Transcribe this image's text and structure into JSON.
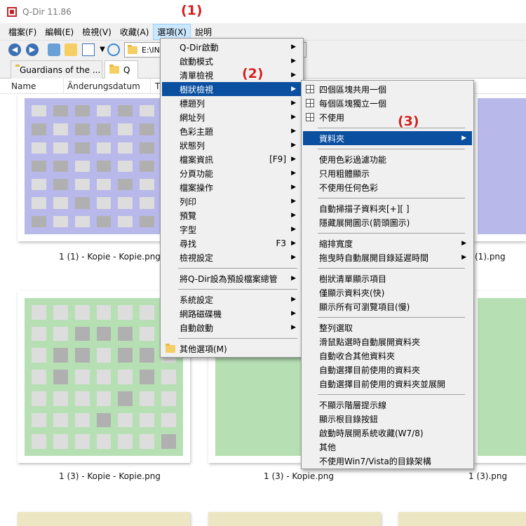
{
  "window": {
    "title": "Q-Dir 11.86"
  },
  "menubar": {
    "items": [
      "檔案(F)",
      "編輯(E)",
      "檢視(V)",
      "收藏(A)",
      "選項(X)",
      "說明"
    ]
  },
  "address": {
    "path": "E:\\INI"
  },
  "tabs": [
    "Guardians of the ...",
    "Q"
  ],
  "columns": {
    "name": "Name",
    "date": "Änderungsdatum",
    "type": "T"
  },
  "annotations": {
    "a1": "(1)",
    "a2": "(2)",
    "a3": "(3)"
  },
  "files": {
    "row1": [
      "1 (1) - Kopie - Kopie.png",
      "(1).png"
    ],
    "row2": [
      "1 (3) - Kopie - Kopie.png",
      "1 (3) - Kopie.png",
      "1 (3).png"
    ]
  },
  "colors": {
    "purple": "#b8b8ea",
    "green": "#b6e0b4",
    "gray": "#b0b0b0",
    "highlight": "#0a4fa0"
  },
  "menu1": {
    "items": [
      "Q-Dir啟動",
      "啟動模式",
      "清單檢視",
      "樹狀檢視",
      "標題列",
      "網址列",
      "色彩主題",
      "狀態列",
      "檔案資訊",
      "分頁功能",
      "檔案操作",
      "列印",
      "預覽",
      "字型",
      "尋找",
      "檢視設定",
      "將Q-Dir設為預設檔案總管",
      "系統設定",
      "網路磁碟機",
      "自動啟動",
      "其他選項(M)"
    ],
    "shortcuts": {
      "file_info": "[F9]",
      "find": "F3"
    }
  },
  "menu2": {
    "items": [
      "四個區塊共用一個",
      "每個區塊獨立一個",
      "不使用",
      "資料夾",
      "使用色彩過濾功能",
      "只用粗體顯示",
      "不使用任何色彩",
      "自動掃描子資料夾[+][ ]",
      "隱藏展開圖示(箭頭圖示)",
      "縮排寬度",
      "拖曳時自動展開目錄延遲時間",
      "樹狀清單顯示項目",
      "僅顯示資料夾(快)",
      "顯示所有可瀏覽項目(慢)",
      "整列選取",
      "滑鼠點選時自動展開資料夾",
      "自動收合其他資料夾",
      "自動選擇目前使用的資料夾",
      "自動選擇目前使用的資料夾並展開",
      "不顯示階層提示線",
      "顯示根目錄按鈕",
      "啟動時展開系統收藏(W7/8)",
      "其他",
      "不使用Win7/Vista的目錄架構"
    ]
  }
}
